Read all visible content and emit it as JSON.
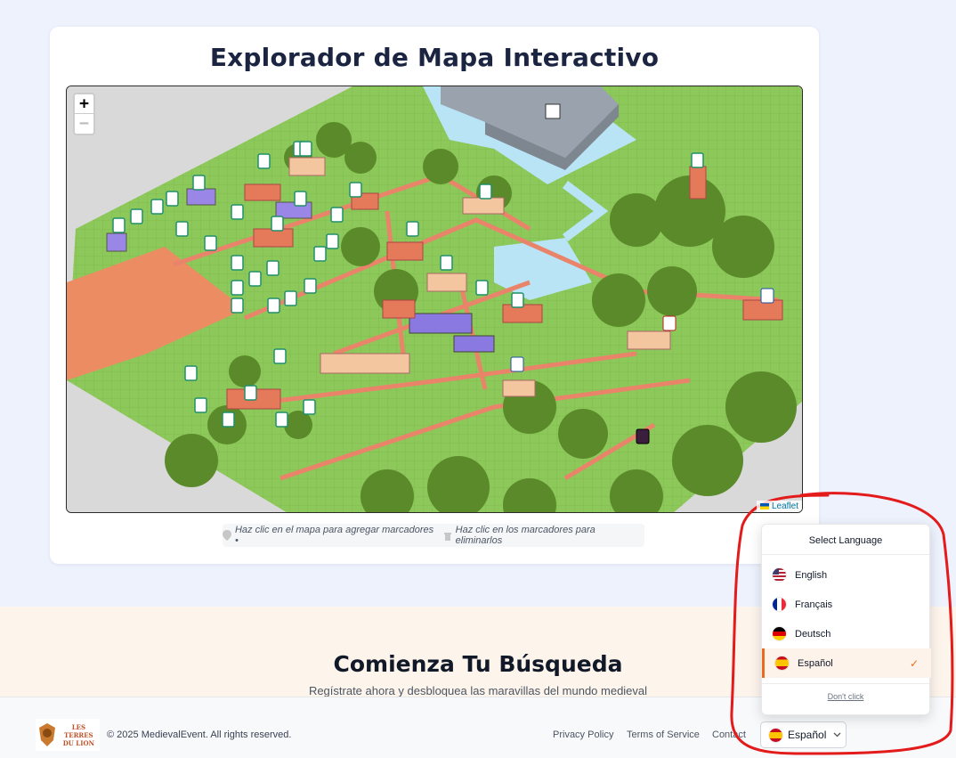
{
  "map_card": {
    "title": "Explorador de Mapa Interactivo",
    "zoom_in_label": "+",
    "zoom_out_label": "−",
    "attribution": "Leaflet",
    "hint_icon_1": "pin-icon",
    "hint_text_1": "Haz clic en el mapa para agregar marcadores •",
    "hint_icon_2": "trash-icon",
    "hint_text_2": "Haz clic en los marcadores para eliminarlos"
  },
  "hero": {
    "title": "Comienza Tu Búsqueda",
    "subtitle": "Regístrate ahora y desbloquea las maravillas del mundo medieval"
  },
  "footer": {
    "logo_line_1": "LES TERRES",
    "logo_line_2": "DU LION",
    "copyright": "© 2025 MedievalEvent. All rights reserved.",
    "links": [
      "Privacy Policy",
      "Terms of Service",
      "Contact"
    ],
    "language_button_label": "Español"
  },
  "language_menu": {
    "title": "Select Language",
    "options": [
      {
        "label": "English",
        "flag": "us-flag-icon",
        "selected": false
      },
      {
        "label": "Français",
        "flag": "fr-flag-icon",
        "selected": false
      },
      {
        "label": "Deutsch",
        "flag": "de-flag-icon",
        "selected": false
      },
      {
        "label": "Español",
        "flag": "es-flag-icon",
        "selected": true
      }
    ],
    "dont_click_label": "Don't click"
  },
  "colors": {
    "accent": "#ea6c1b",
    "grass": "#8dc95a",
    "road": "#e98a66",
    "water": "#b7e3f4",
    "annotation": "#e31b1b"
  }
}
